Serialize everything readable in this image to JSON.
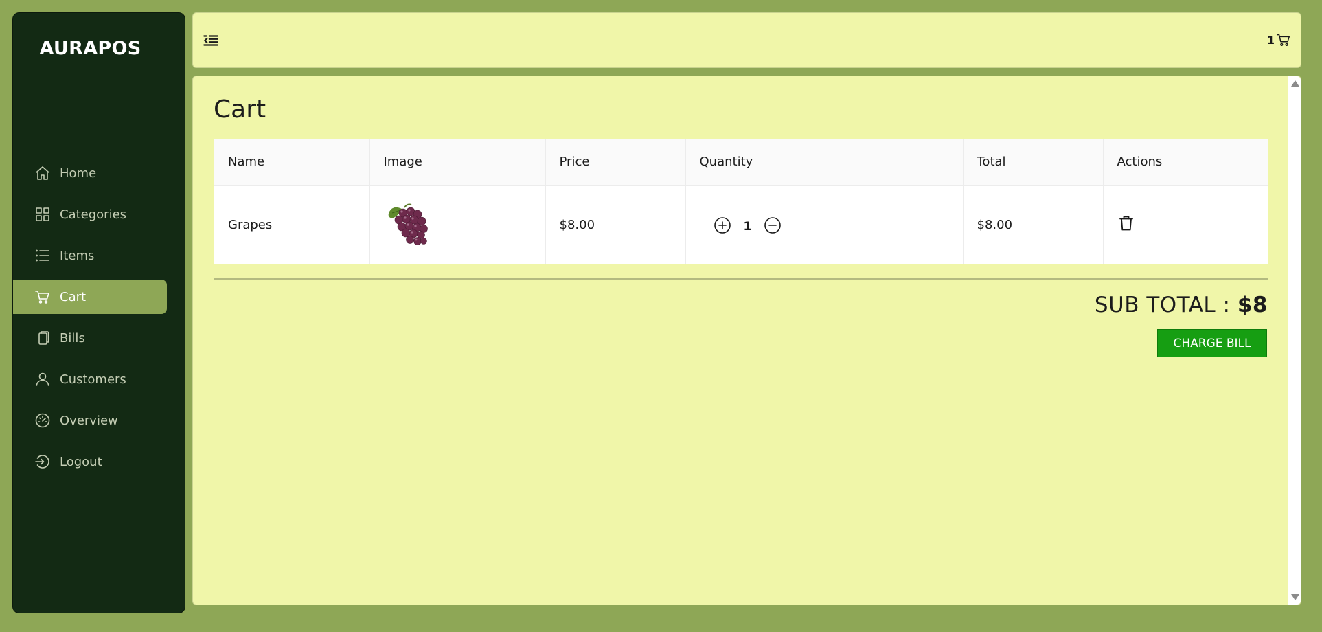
{
  "app": {
    "name": "AURAPOS"
  },
  "sidebar": {
    "items": [
      {
        "label": "Home",
        "icon": "home-icon"
      },
      {
        "label": "Categories",
        "icon": "grid-icon"
      },
      {
        "label": "Items",
        "icon": "list-icon"
      },
      {
        "label": "Cart",
        "icon": "cart-icon",
        "active": true
      },
      {
        "label": "Bills",
        "icon": "copy-icon"
      },
      {
        "label": "Customers",
        "icon": "user-icon"
      },
      {
        "label": "Overview",
        "icon": "speedometer-icon"
      },
      {
        "label": "Logout",
        "icon": "logout-icon"
      }
    ]
  },
  "header": {
    "cart_count": "1",
    "toggle_icon": "sidebar-collapse-icon"
  },
  "cart": {
    "title": "Cart",
    "columns": [
      "Name",
      "Image",
      "Price",
      "Quantity",
      "Total",
      "Actions"
    ],
    "rows": [
      {
        "name": "Grapes",
        "image": "grapes-image",
        "price": "$8.00",
        "quantity": "1",
        "total": "$8.00"
      }
    ],
    "subtotal_label": "SUB TOTAL : ",
    "subtotal_value": "$8",
    "charge_label": "CHARGE BILL"
  },
  "colors": {
    "background": "#8ea756",
    "sidebar": "#132a14",
    "panel": "#f0f6a9",
    "active": "#8ea756",
    "charge_button": "#169e12"
  }
}
